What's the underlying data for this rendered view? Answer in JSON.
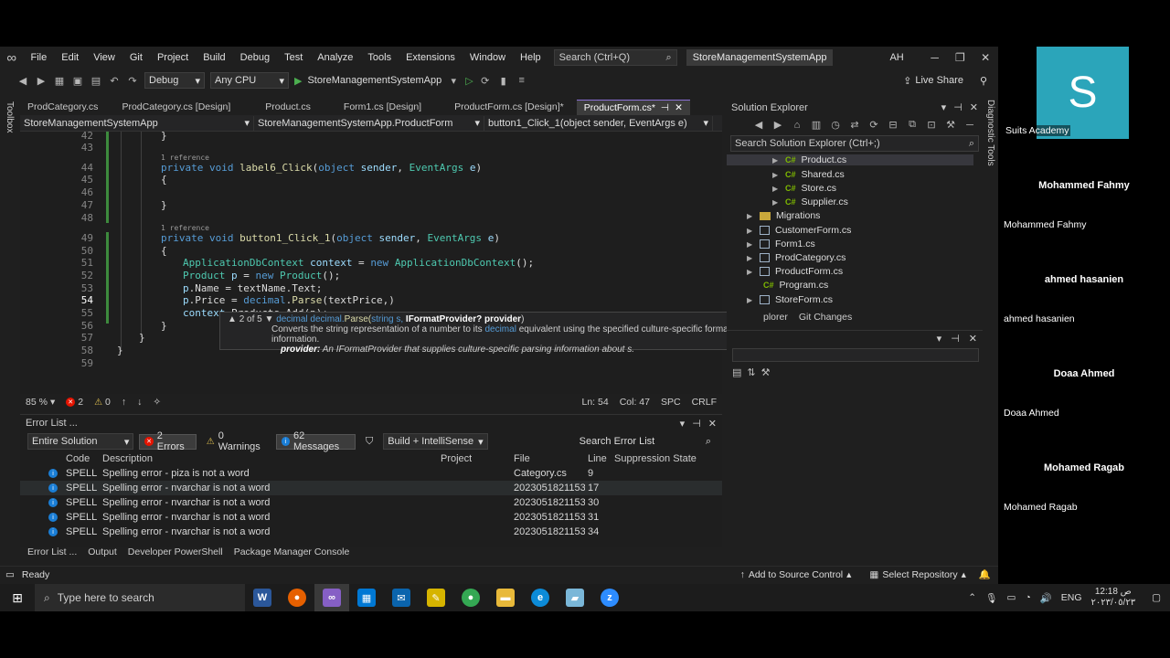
{
  "menu": {
    "items": [
      "File",
      "Edit",
      "View",
      "Git",
      "Project",
      "Build",
      "Debug",
      "Test",
      "Analyze",
      "Tools",
      "Extensions",
      "Window",
      "Help"
    ],
    "search_placeholder": "Search (Ctrl+Q)",
    "solution_title": "StoreManagementSystemApp",
    "user_initials": "AH"
  },
  "toolbar": {
    "config": "Debug",
    "platform": "Any CPU",
    "run_target": "StoreManagementSystemApp",
    "live_share": "Live Share"
  },
  "side_strips": {
    "left": "Toolbox",
    "right": "Diagnostic Tools"
  },
  "tabs": [
    {
      "label": "ProdCategory.cs"
    },
    {
      "label": "ProdCategory.cs [Design]"
    },
    {
      "label": "Product.cs"
    },
    {
      "label": "Form1.cs [Design]"
    },
    {
      "label": "ProductForm.cs [Design]*"
    },
    {
      "label": "ProductForm.cs*"
    }
  ],
  "navbar": {
    "project": "StoreManagementSystemApp",
    "class": "StoreManagementSystemApp.ProductForm",
    "member": "button1_Click_1(object sender, EventArgs e)"
  },
  "editor": {
    "line_numbers": [
      "42",
      "43",
      "44",
      "45",
      "46",
      "47",
      "48",
      "49",
      "50",
      "51",
      "52",
      "53",
      "54",
      "55",
      "56",
      "57",
      "58",
      "59"
    ],
    "reference_hint": "1 reference",
    "zoom": "85 %",
    "errors": "2",
    "warnings": "0",
    "ln": "Ln: 54",
    "col": "Col: 47",
    "spc": "SPC",
    "crlf": "CRLF"
  },
  "tooltip": {
    "counter": "2 of 5",
    "signature_a": "decimal decimal.",
    "signature_b": "Parse(",
    "signature_c": "string s, ",
    "signature_d": "IFormatProvider? provider",
    "signature_e": ")",
    "desc_a": "Converts the string representation of a number to its ",
    "desc_b": "decimal",
    "desc_c": " equivalent using the specified culture-specific format information.",
    "param_name": "provider:",
    "param_desc": " An IFormatProvider that supplies culture-specific parsing information about s."
  },
  "error_list": {
    "title": "Error List ...",
    "scope": "Entire Solution",
    "errors_chip": "2 Errors",
    "warnings_chip": "0 Warnings",
    "messages_chip": "62 Messages",
    "build_filter": "Build + IntelliSense",
    "search_placeholder": "Search Error List",
    "columns": {
      "code": "Code",
      "description": "Description",
      "project": "Project",
      "file": "File",
      "line": "Line",
      "suppression": "Suppression State"
    },
    "rows": [
      {
        "code": "SPELL",
        "description": "Spelling error - piza is not a word",
        "file": "Category.cs",
        "line": "9"
      },
      {
        "code": "SPELL",
        "description": "Spelling error - nvarchar is not a word",
        "file": "20230518211535_...",
        "line": "17"
      },
      {
        "code": "SPELL",
        "description": "Spelling error - nvarchar is not a word",
        "file": "20230518211535_...",
        "line": "30"
      },
      {
        "code": "SPELL",
        "description": "Spelling error - nvarchar is not a word",
        "file": "20230518211535_...",
        "line": "31"
      },
      {
        "code": "SPELL",
        "description": "Spelling error - nvarchar is not a word",
        "file": "20230518211535_...",
        "line": "34"
      }
    ],
    "bottom_tabs": [
      "Error List ...",
      "Output",
      "Developer PowerShell",
      "Package Manager Console"
    ]
  },
  "solution_explorer": {
    "title": "Solution Explorer",
    "search_placeholder": "Search Solution Explorer (Ctrl+;)",
    "items": [
      "Product.cs",
      "Shared.cs",
      "Store.cs",
      "Supplier.cs",
      "Migrations",
      "CustomerForm.cs",
      "Form1.cs",
      "ProdCategory.cs",
      "ProductForm.cs",
      "Program.cs",
      "StoreForm.cs"
    ],
    "tabs": [
      "plorer",
      "Git Changes"
    ]
  },
  "status_bar": {
    "ready": "Ready",
    "source_control": "Add to Source Control",
    "repository": "Select Repository"
  },
  "zoom_panel": {
    "host_initial": "S",
    "host_label": "Suits Academy",
    "participants": [
      {
        "name": "Mohammed Fahmy",
        "label": "Mohammed Fahmy"
      },
      {
        "name": "ahmed hasanien",
        "label": "ahmed hasanien"
      },
      {
        "name": "Doaa Ahmed",
        "label": "Doaa Ahmed"
      },
      {
        "name": "Mohamed Ragab",
        "label": "Mohamed Ragab"
      }
    ]
  },
  "taskbar": {
    "search_placeholder": "Type here to search",
    "language": "ENG",
    "time": "12:18 ص",
    "date": "٢٠٢٣/٠٥/٢٣"
  },
  "colors": {
    "accent": "#8a6fd6",
    "zoom_host": "#2ba5ba",
    "keyword": "#569cd6",
    "type": "#4ec9b0"
  }
}
